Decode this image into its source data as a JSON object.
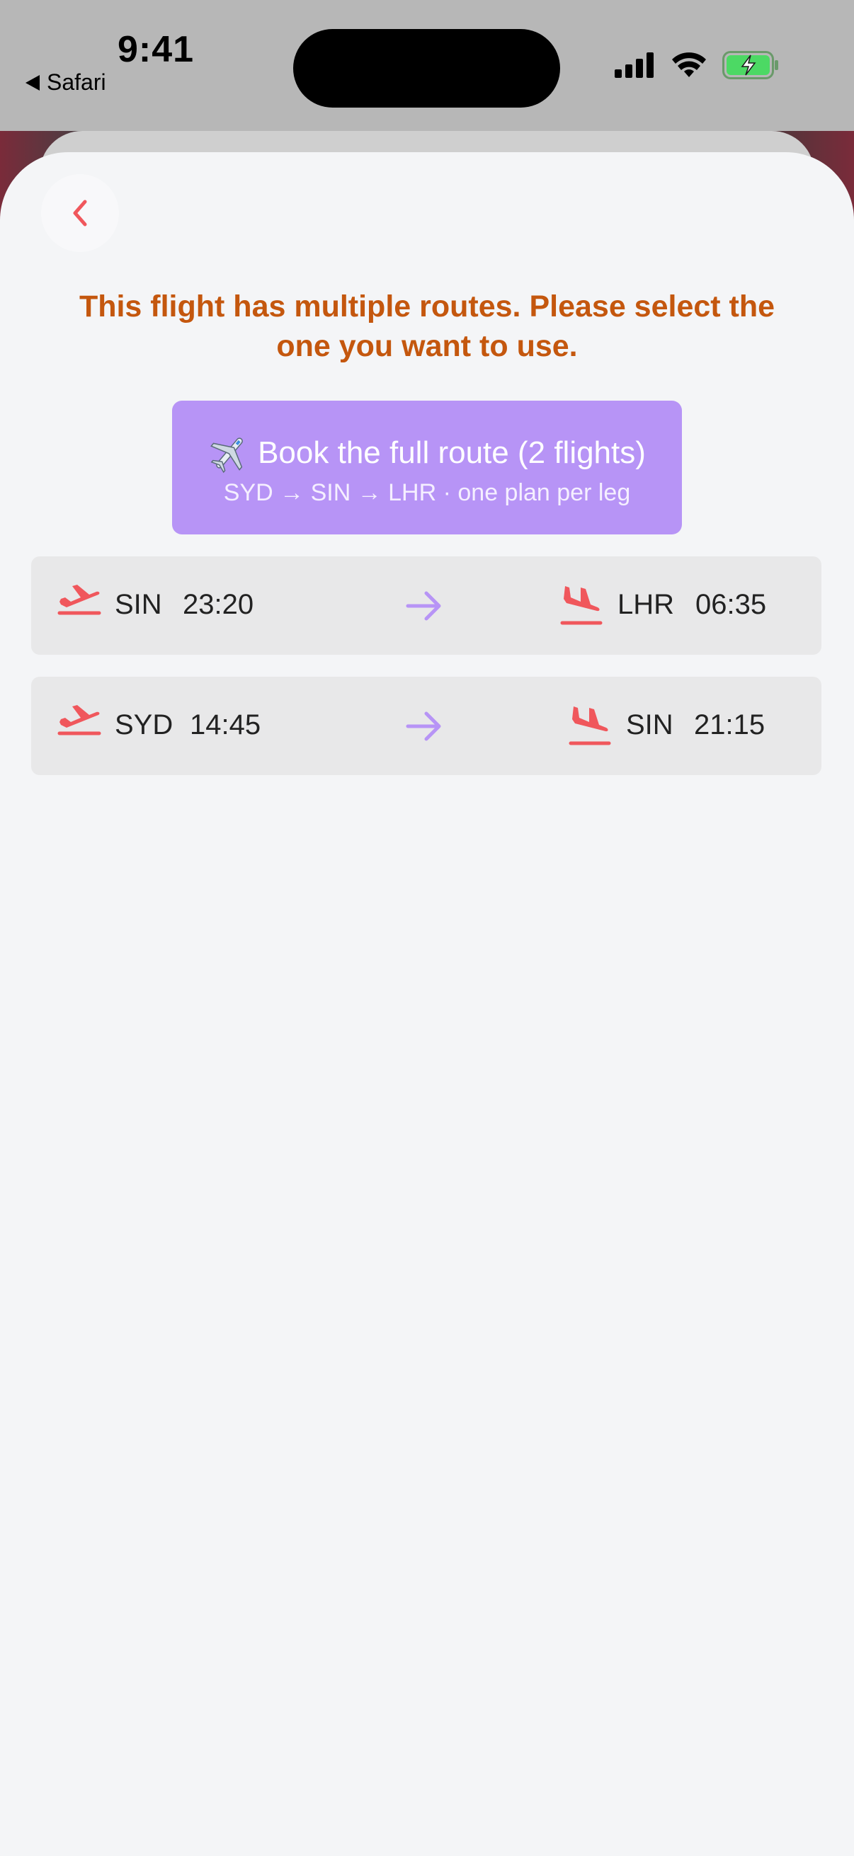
{
  "status_bar": {
    "time": "9:41",
    "back_app": "Safari"
  },
  "header": {
    "title": "This flight has multiple routes. Please select the one you want to use."
  },
  "full_route_button": {
    "label": "Book the full route (2 flights)",
    "subtitle": "SYD → SIN → LHR · one plan per leg",
    "icon": "airplane-emoji"
  },
  "legs": [
    {
      "from": "SIN",
      "dep_time": "23:20",
      "to": "LHR",
      "arr_time": "06:35"
    },
    {
      "from": "SYD",
      "dep_time": "14:45",
      "to": "SIN",
      "arr_time": "21:15"
    }
  ],
  "colors": {
    "accent": "#b794f6",
    "title": "#c4570e",
    "icon_red": "#f0575c",
    "arrow": "#b794f6"
  }
}
